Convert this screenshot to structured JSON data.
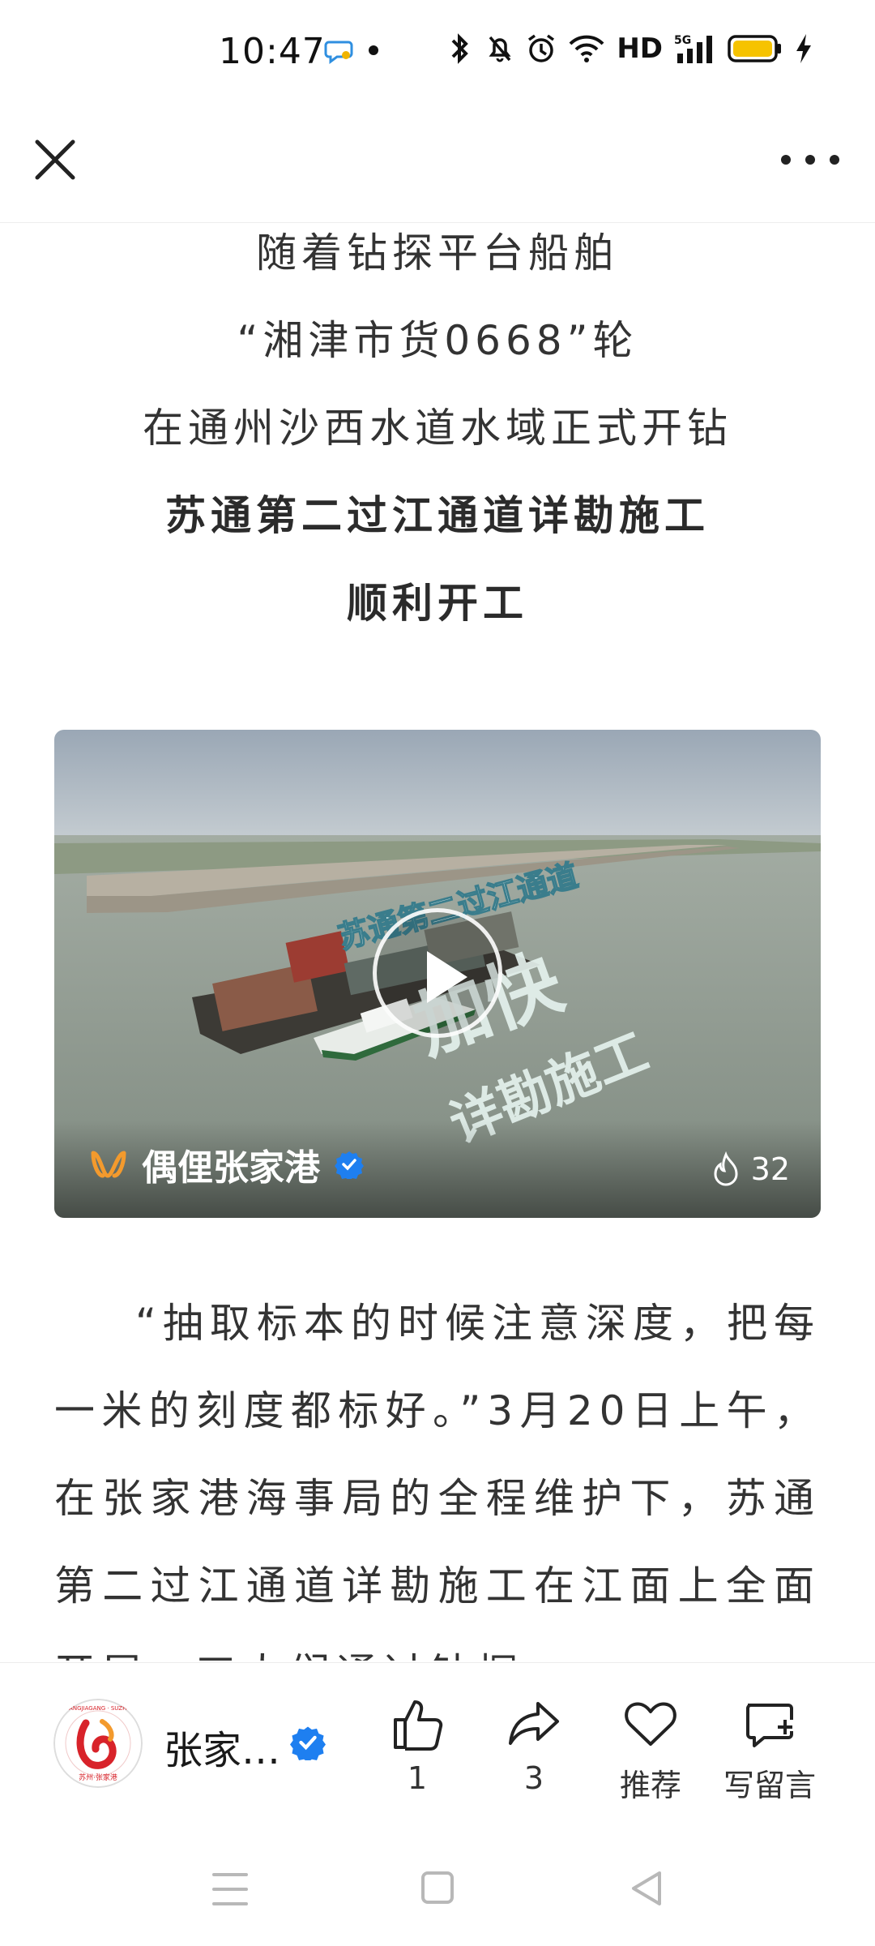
{
  "status_bar": {
    "time": "10:47",
    "network_label": "HD",
    "signal_label": "5G",
    "icons": [
      "chat-bubble-icon",
      "dot-icon",
      "bluetooth-icon",
      "mute-bell-icon",
      "alarm-icon",
      "wifi-icon",
      "signal-icon",
      "battery-icon",
      "charging-icon"
    ]
  },
  "topbar": {
    "close_icon": "close-icon",
    "more_icon": "more-icon"
  },
  "article": {
    "headings": [
      "随着钻探平台船舶",
      "“湘津市货0668”轮",
      "在通州沙西水道水域正式开钻",
      "苏通第二过江通道详勘施工",
      "顺利开工"
    ],
    "video": {
      "overlay_title": "苏通第二过江通道",
      "overlay_line1": "加快",
      "overlay_line2": "详勘施工",
      "channel_name": "偶俚张家港",
      "heat_count": "32"
    },
    "body": "“抽取标本的时候注意深度，把每一米的刻度都标好。”3月20日上午，在张家港海事局的全程维护下，苏通第二过江通道详勘施工在江面上全面开展，工人们通过钻探"
  },
  "action_bar": {
    "account_name": "张家…",
    "avatar_text_top": "ZHANGJIAGANG · SUZHOU",
    "avatar_text_bottom": "苏州·张家港",
    "like_count": "1",
    "share_count": "3",
    "recommend_label": "推荐",
    "comment_label": "写留言"
  },
  "colors": {
    "verified_blue": "#1e7ff0",
    "brand_red": "#d8232a",
    "brand_orange": "#f39a2d"
  }
}
